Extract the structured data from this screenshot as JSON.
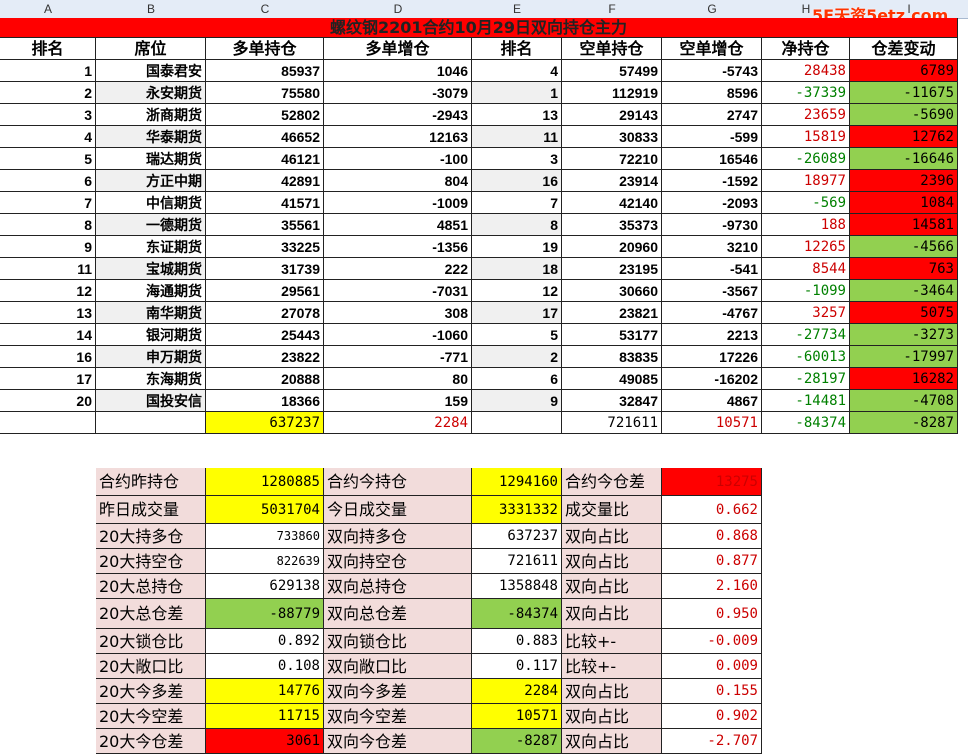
{
  "column_letters": [
    "A",
    "B",
    "C",
    "D",
    "E",
    "F",
    "G",
    "H",
    "I"
  ],
  "watermark": "5E天资5etz.com",
  "title": "螺纹钢2201合约10月29日双向持仓主力",
  "headers": [
    "排名",
    "席位",
    "多单持仓",
    "多单增仓",
    "排名",
    "空单持仓",
    "空单增仓",
    "净持仓",
    "仓差变动"
  ],
  "rows": [
    {
      "rank": "1",
      "seat": "国泰君安",
      "long": "85937",
      "long_chg": "1046",
      "rank2": "4",
      "short": "57499",
      "short_chg": "-5743",
      "net": "28438",
      "diff": "6789"
    },
    {
      "rank": "2",
      "seat": "永安期货",
      "long": "75580",
      "long_chg": "-3079",
      "rank2": "1",
      "short": "112919",
      "short_chg": "8596",
      "net": "-37339",
      "diff": "-11675"
    },
    {
      "rank": "3",
      "seat": "浙商期货",
      "long": "52802",
      "long_chg": "-2943",
      "rank2": "13",
      "short": "29143",
      "short_chg": "2747",
      "net": "23659",
      "diff": "-5690"
    },
    {
      "rank": "4",
      "seat": "华泰期货",
      "long": "46652",
      "long_chg": "12163",
      "rank2": "11",
      "short": "30833",
      "short_chg": "-599",
      "net": "15819",
      "diff": "12762"
    },
    {
      "rank": "5",
      "seat": "瑞达期货",
      "long": "46121",
      "long_chg": "-100",
      "rank2": "3",
      "short": "72210",
      "short_chg": "16546",
      "net": "-26089",
      "diff": "-16646"
    },
    {
      "rank": "6",
      "seat": "方正中期",
      "long": "42891",
      "long_chg": "804",
      "rank2": "16",
      "short": "23914",
      "short_chg": "-1592",
      "net": "18977",
      "diff": "2396"
    },
    {
      "rank": "7",
      "seat": "中信期货",
      "long": "41571",
      "long_chg": "-1009",
      "rank2": "7",
      "short": "42140",
      "short_chg": "-2093",
      "net": "-569",
      "diff": "1084"
    },
    {
      "rank": "8",
      "seat": "一德期货",
      "long": "35561",
      "long_chg": "4851",
      "rank2": "8",
      "short": "35373",
      "short_chg": "-9730",
      "net": "188",
      "diff": "14581"
    },
    {
      "rank": "9",
      "seat": "东证期货",
      "long": "33225",
      "long_chg": "-1356",
      "rank2": "19",
      "short": "20960",
      "short_chg": "3210",
      "net": "12265",
      "diff": "-4566"
    },
    {
      "rank": "11",
      "seat": "宝城期货",
      "long": "31739",
      "long_chg": "222",
      "rank2": "18",
      "short": "23195",
      "short_chg": "-541",
      "net": "8544",
      "diff": "763"
    },
    {
      "rank": "12",
      "seat": "海通期货",
      "long": "29561",
      "long_chg": "-7031",
      "rank2": "12",
      "short": "30660",
      "short_chg": "-3567",
      "net": "-1099",
      "diff": "-3464"
    },
    {
      "rank": "13",
      "seat": "南华期货",
      "long": "27078",
      "long_chg": "308",
      "rank2": "17",
      "short": "23821",
      "short_chg": "-4767",
      "net": "3257",
      "diff": "5075"
    },
    {
      "rank": "14",
      "seat": "银河期货",
      "long": "25443",
      "long_chg": "-1060",
      "rank2": "5",
      "short": "53177",
      "short_chg": "2213",
      "net": "-27734",
      "diff": "-3273"
    },
    {
      "rank": "16",
      "seat": "申万期货",
      "long": "23822",
      "long_chg": "-771",
      "rank2": "2",
      "short": "83835",
      "short_chg": "17226",
      "net": "-60013",
      "diff": "-17997"
    },
    {
      "rank": "17",
      "seat": "东海期货",
      "long": "20888",
      "long_chg": "80",
      "rank2": "6",
      "short": "49085",
      "short_chg": "-16202",
      "net": "-28197",
      "diff": "16282"
    },
    {
      "rank": "20",
      "seat": "国投安信",
      "long": "18366",
      "long_chg": "159",
      "rank2": "9",
      "short": "32847",
      "short_chg": "4867",
      "net": "-14481",
      "diff": "-4708"
    }
  ],
  "totals": {
    "long": "637237",
    "long_chg": "2284",
    "short": "721611",
    "short_chg": "10571",
    "net": "-84374",
    "diff": "-8287"
  },
  "summary": [
    {
      "l1": "合约昨持仓",
      "v1": "1280885",
      "l2": "合约今持仓",
      "v2": "1294160",
      "l3": "合约今仓差",
      "v3": "13275"
    },
    {
      "l1": "昨日成交量",
      "v1": "5031704",
      "l2": "今日成交量",
      "v2": "3331332",
      "l3": "成交量比",
      "v3": "0.662"
    },
    {
      "l1": "20大持多仓",
      "v1": "733860",
      "l2": "双向持多仓",
      "v2": "637237",
      "l3": "双向占比",
      "v3": "0.868"
    },
    {
      "l1": "20大持空仓",
      "v1": "822639",
      "l2": "双向持空仓",
      "v2": "721611",
      "l3": "双向占比",
      "v3": "0.877"
    },
    {
      "l1": "20大总持仓",
      "v1": "629138",
      "l2": "双向总持仓",
      "v2": "1358848",
      "l3": "双向占比",
      "v3": "2.160"
    },
    {
      "l1": "20大总仓差",
      "v1": "-88779",
      "l2": "双向总仓差",
      "v2": "-84374",
      "l3": "双向占比",
      "v3": "0.950"
    },
    {
      "l1": "20大锁仓比",
      "v1": "0.892",
      "l2": "双向锁仓比",
      "v2": "0.883",
      "l3": "比较+-",
      "v3": "-0.009"
    },
    {
      "l1": "20大敞口比",
      "v1": "0.108",
      "l2": "双向敞口比",
      "v2": "0.117",
      "l3": "比较+-",
      "v3": "0.009"
    },
    {
      "l1": "20大今多差",
      "v1": "14776",
      "l2": "双向今多差",
      "v2": "2284",
      "l3": "双向占比",
      "v3": "0.155"
    },
    {
      "l1": "20大今空差",
      "v1": "11715",
      "l2": "双向今空差",
      "v2": "10571",
      "l3": "双向占比",
      "v3": "0.902"
    },
    {
      "l1": "20大今仓差",
      "v1": "3061",
      "l2": "双向今仓差",
      "v2": "-8287",
      "l3": "双向占比",
      "v3": "-2.707"
    }
  ]
}
